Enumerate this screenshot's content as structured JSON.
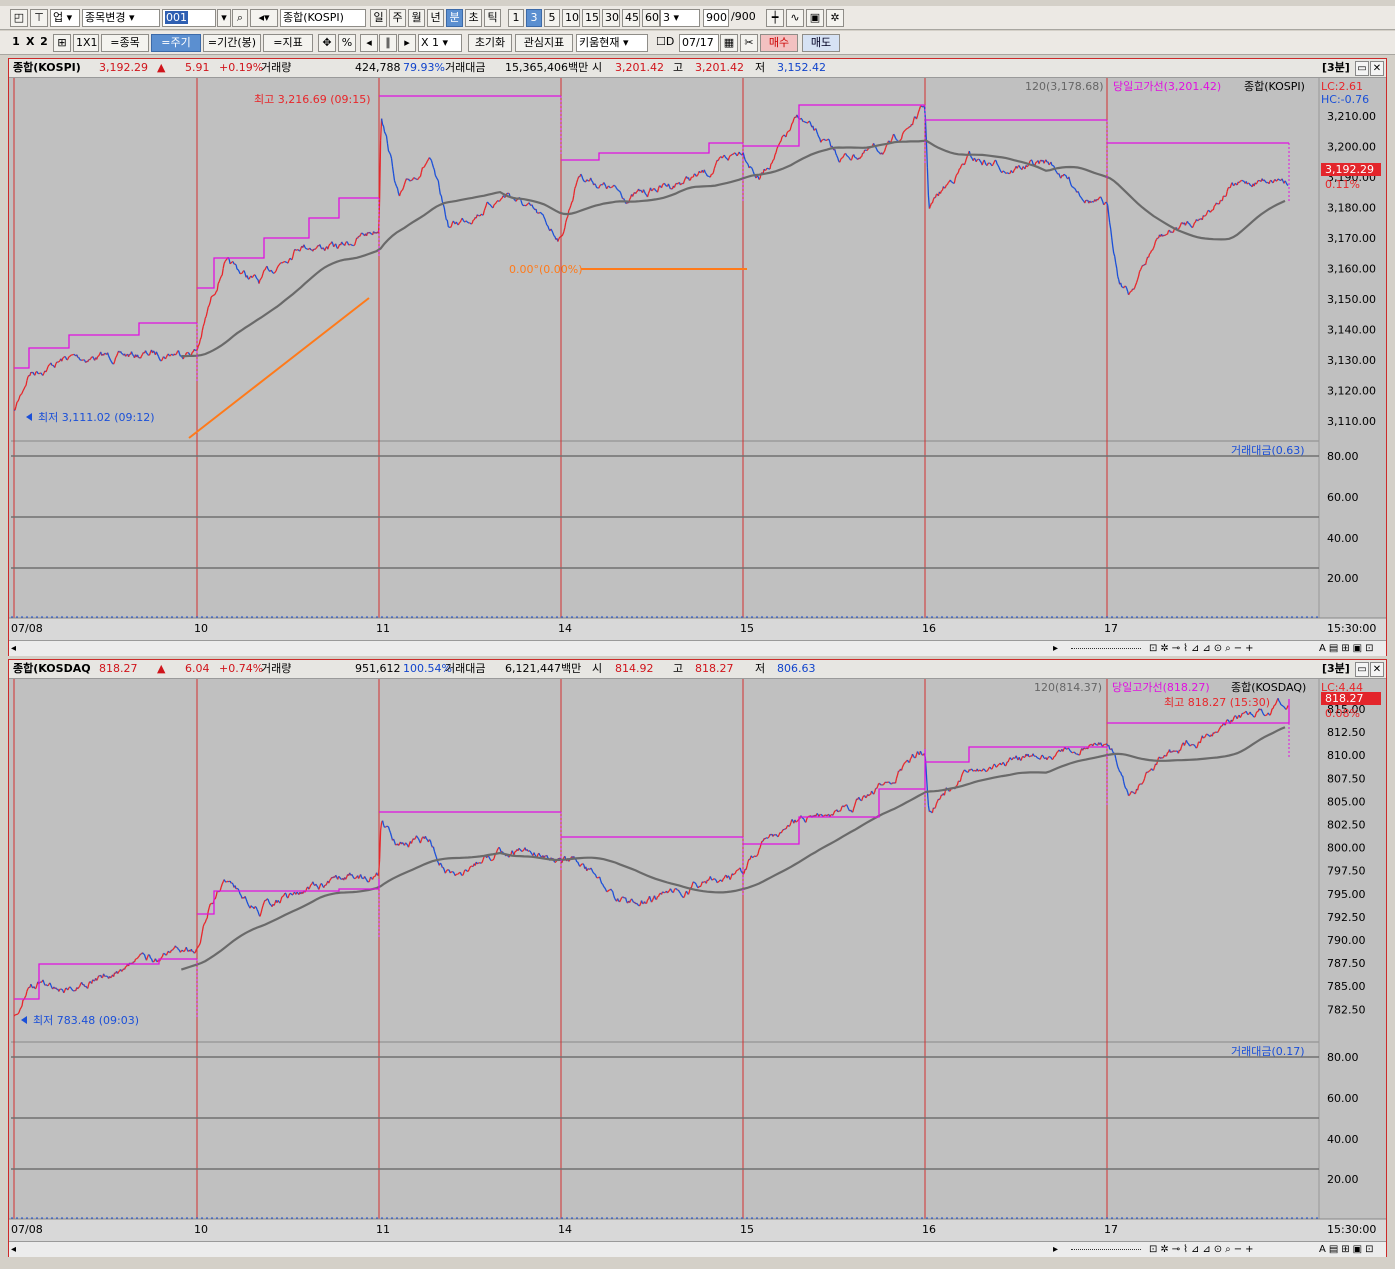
{
  "toolbar1": {
    "market": "업",
    "change_item": "종목변경",
    "code": "001",
    "name": "종합(KOSPI)",
    "periods": [
      "일",
      "주",
      "월",
      "년",
      "분",
      "초",
      "틱"
    ],
    "active_period": "분",
    "intervals": [
      "1",
      "3",
      "5",
      "10",
      "15",
      "30",
      "45",
      "60"
    ],
    "active_interval": "3",
    "interval_select": "3",
    "count": "900",
    "count_total": "/900"
  },
  "toolbar2": {
    "layout_1": "1",
    "layout_x": "X",
    "layout_2": "2",
    "grid": "1X1",
    "btn_item": "=종목",
    "btn_period": "=주기",
    "btn_range": "=기간(봉)",
    "btn_indicator": "=지표",
    "percent": "%",
    "zoom": "X 1",
    "reset": "초기화",
    "interest": "관심지표",
    "kiwoom": "키움현재",
    "d_label": "D",
    "date": "07/17",
    "buy": "매수",
    "sell": "매도"
  },
  "panels": [
    {
      "name": "종합(KOSPI)",
      "price": "3,192.29",
      "arrow": "▲",
      "change": "5.91",
      "change_pct": "+0.19%",
      "vol_label": "거래량",
      "volume": "424,788",
      "vol_ratio": "79.93%",
      "amt_label": "거래대금",
      "amount": "15,365,406백만",
      "open_label": "시",
      "open": "3,201.42",
      "high_label": "고",
      "high": "3,201.42",
      "low_label": "저",
      "low": "3,152.42",
      "interval_tag": "[3분]",
      "legend_ma": "120(3,178.68)",
      "legend_high": "당일고가선(3,201.42)",
      "legend_name": "종합(KOSPI)",
      "lc": "LC:2.61",
      "hc": "HC:-0.76",
      "price_tag": "3,192.29",
      "price_tag_pct": "0.11%",
      "max_label": "최고 3,216.69 (09:15)",
      "min_label": "최저 3,111.02 (09:12)",
      "ratio_label": "0.00°(0.00%)",
      "sub_legend": "거래대금(0.63)",
      "y_ticks": [
        "3,210.00",
        "3,200.00",
        "3,190.00",
        "3,180.00",
        "3,170.00",
        "3,160.00",
        "3,150.00",
        "3,140.00",
        "3,130.00",
        "3,120.00",
        "3,110.00"
      ],
      "sub_ticks": [
        "80.00",
        "60.00",
        "40.00",
        "20.00"
      ],
      "x_labels": [
        "07/08",
        "10",
        "11",
        "14",
        "15",
        "16",
        "17"
      ],
      "x_end": "15:30:00"
    },
    {
      "name": "종합(KOSDAQ",
      "price": "818.27",
      "arrow": "▲",
      "change": "6.04",
      "change_pct": "+0.74%",
      "vol_label": "거래량",
      "volume": "951,612",
      "vol_ratio": "100.54%",
      "amt_label": "거래대금",
      "amount": "6,121,447백만",
      "open_label": "시",
      "open": "814.92",
      "high_label": "고",
      "high": "818.27",
      "low_label": "저",
      "low": "806.63",
      "interval_tag": "[3분]",
      "legend_ma": "120(814.37)",
      "legend_high": "당일고가선(818.27)",
      "legend_name": "종합(KOSDAQ)",
      "lc": "LC:4.44",
      "price_tag": "818.27",
      "price_tag_pct": "0.08%",
      "max_label": "최고 818.27 (15:30)",
      "min_label": "최저 783.48 (09:03)",
      "sub_legend": "거래대금(0.17)",
      "y_ticks": [
        "815.00",
        "812.50",
        "810.00",
        "807.50",
        "805.00",
        "802.50",
        "800.00",
        "797.50",
        "795.00",
        "792.50",
        "790.00",
        "787.50",
        "785.00",
        "782.50"
      ],
      "sub_ticks": [
        "80.00",
        "60.00",
        "40.00",
        "20.00"
      ],
      "x_labels": [
        "07/08",
        "10",
        "11",
        "14",
        "15",
        "16",
        "17"
      ],
      "x_end": "15:30:00"
    }
  ],
  "colors": {
    "up": "#e8262a",
    "down": "#1a4fd8",
    "high_line": "#e010e0",
    "ma": "#6a6a6a",
    "trend": "#ff7a1a",
    "sep": "#d23030"
  }
}
